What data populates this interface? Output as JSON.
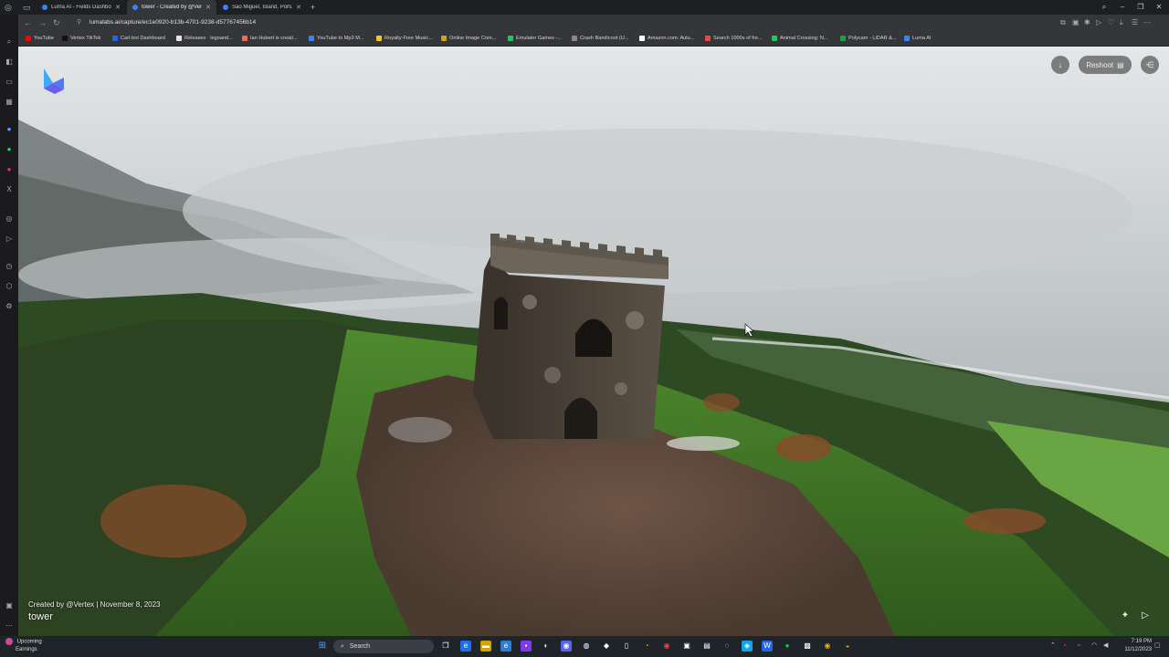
{
  "browser": {
    "tabs": [
      {
        "label": "Luma AI - Fields Dashboard",
        "color": "#3b82f6",
        "active": false
      },
      {
        "label": "tower - Created by @Vertex",
        "color": "#3b82f6",
        "active": true
      },
      {
        "label": "Sao Miguel, Island, Portugal",
        "color": "#3b82f6",
        "active": false
      }
    ],
    "url": "lumalabs.ai/capture/ec1e0920-b13b-4701-9238-d57767456b14",
    "bookmarks": [
      {
        "label": "YouTube",
        "color": "#ff0000"
      },
      {
        "label": "Vertex TikTok",
        "color": "#111111"
      },
      {
        "label": "Carl-bot Dashboard",
        "color": "#2563eb"
      },
      {
        "label": "Releases · legoand...",
        "color": "#e5e5e5"
      },
      {
        "label": "Ian Hubert is creati...",
        "color": "#f96854"
      },
      {
        "label": "YouTube to Mp3 M...",
        "color": "#3b82f6"
      },
      {
        "label": "Royalty-Free Music...",
        "color": "#f5c518"
      },
      {
        "label": "Online Image Com...",
        "color": "#d4a017"
      },
      {
        "label": "Emulator Games -...",
        "color": "#22c55e"
      },
      {
        "label": "Crash Bandicoot (U...",
        "color": "#888888"
      },
      {
        "label": "Amazon.com: Aulu...",
        "color": "#ffffff"
      },
      {
        "label": "Search 1000s of fre...",
        "color": "#e74c3c"
      },
      {
        "label": "Animal Crossing: N...",
        "color": "#22c55e"
      },
      {
        "label": "Polycam - LiDAR &...",
        "color": "#16a34a"
      },
      {
        "label": "Luma AI",
        "color": "#3b82f6"
      }
    ]
  },
  "viewer": {
    "reshoot_label": "Reshoot",
    "credit": "Created by @Vertex | November 8, 2023",
    "title": "tower"
  },
  "taskbar": {
    "weather_title": "Upcoming",
    "weather_sub": "Earnings",
    "search_placeholder": "Search",
    "time": "7:19 PM",
    "date": "11/12/2023"
  }
}
